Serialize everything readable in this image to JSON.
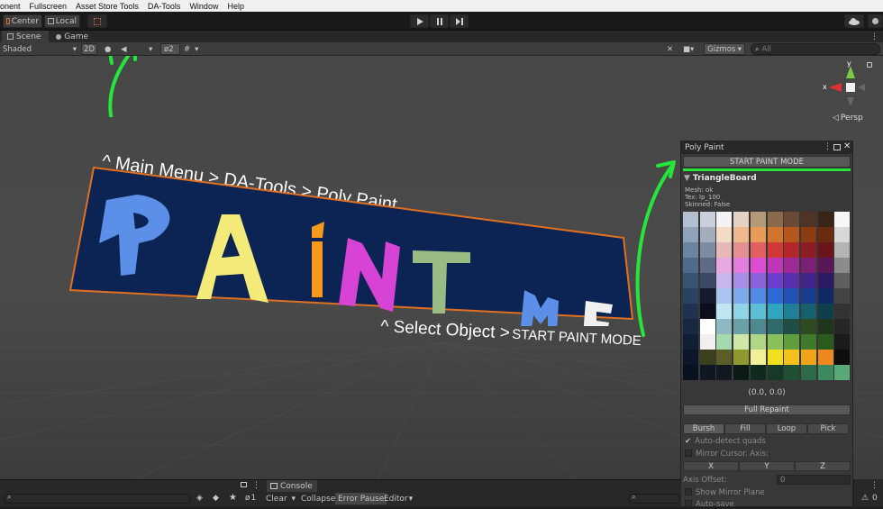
{
  "menubar": {
    "items": [
      "onent",
      "Fullscreen",
      "Asset Store Tools",
      "DA-Tools",
      "Window",
      "Help"
    ]
  },
  "toolbar": {
    "center_label": "Center",
    "local_label": "Local",
    "play_icon": "play-icon",
    "pause_icon": "pause-icon",
    "step_icon": "step-icon"
  },
  "tabs": {
    "scene": "Scene",
    "game": "Game"
  },
  "scene_toolbar": {
    "shading_mode": "Shaded",
    "mode_2d": "2D",
    "hidden_count": "2",
    "gizmos_label": "Gizmos",
    "search_placeholder": "All"
  },
  "gizmo": {
    "x_label": "x",
    "y_label": "y",
    "projection": "Persp"
  },
  "annotations": {
    "main_menu_hint": "^ Main Menu > DA-Tools > Poly Paint",
    "select_hint_prefix": "^ Select Object >",
    "select_hint_action": "START PAINT MODE",
    "arrow_color": "#25e53a"
  },
  "board": {
    "word1": "PAINT",
    "word2": "ME",
    "background": "#0b2454",
    "border": "#e0701f",
    "letter_colors": [
      "#5b8fe8",
      "#f3ea7a",
      "#f59a1a",
      "#d743d4",
      "#9abb83",
      "#5b8fe8",
      "#f0f0f0"
    ]
  },
  "poly_paint": {
    "title": "Poly Paint",
    "start_button": "START PAINT MODE",
    "object_name": "TriangleBoard",
    "mesh_info": "Mesh: ok",
    "tex_info": "Tex: lp_100",
    "skinned_info": "Skinned: False",
    "coords": "(0.0, 0.0)",
    "full_repaint": "Full Repaint",
    "tool_tabs": [
      "Bursh",
      "Fill",
      "Loop",
      "Pick"
    ],
    "auto_detect_quads": "Auto-detect quads",
    "mirror_cursor": "Mirror Cursor. Axis:",
    "axes": [
      "X",
      "Y",
      "Z"
    ],
    "axis_offset_label": "Axis Offset:",
    "axis_offset_value": "0",
    "show_mirror_plane": "Show Mirror Plane",
    "auto_save": "Auto-save",
    "palette": [
      [
        "#b2bfd1",
        "#c9d0db",
        "#f3f3f3",
        "#e2d3c5",
        "#b59a78",
        "#8a6a4b",
        "#6a4a36",
        "#4f3325",
        "#3a2418",
        "#f7f7f7"
      ],
      [
        "#8ea2b9",
        "#a3adbc",
        "#f3dcc6",
        "#efb98e",
        "#e89a58",
        "#d1742e",
        "#b3571e",
        "#8c3c13",
        "#6c2a0e",
        "#d8d8d8"
      ],
      [
        "#6b84a0",
        "#7f8ba0",
        "#e6b8b8",
        "#e49090",
        "#e06060",
        "#d23838",
        "#b3262a",
        "#8d1c23",
        "#6b1419",
        "#b4b4b4"
      ],
      [
        "#4f6a8a",
        "#5d6b85",
        "#e8a9e3",
        "#e27fde",
        "#db4ed4",
        "#bf36b9",
        "#9b2a95",
        "#7a2075",
        "#5a1757",
        "#8c8c8c"
      ],
      [
        "#3a5372",
        "#3a4864",
        "#c8b6ef",
        "#a98de6",
        "#8a62dc",
        "#6d3fd0",
        "#5630ad",
        "#412488",
        "#2d1962",
        "#5f5f5f"
      ],
      [
        "#2b4260",
        "#141a2e",
        "#a9c4f0",
        "#7ea9ec",
        "#4f8ae6",
        "#2d6ad8",
        "#2152b4",
        "#183d8d",
        "#0f2964",
        "#444444"
      ],
      [
        "#1f3350",
        "#0b0f1c",
        "#bfe6f2",
        "#8ed3e6",
        "#5cbfd6",
        "#2fa5bf",
        "#207f94",
        "#185f6e",
        "#0f3f4a",
        "#333333"
      ],
      [
        "#162842",
        "#ffffff",
        "#8fb9c2",
        "#6aa0a8",
        "#4d8a8f",
        "#2e6b6a",
        "#1f4e45",
        "#2e4a1f",
        "#20361a",
        "#262626"
      ],
      [
        "#101f35",
        "#f0f0f0",
        "#a6d9b0",
        "#cfe8a8",
        "#aed685",
        "#89c05c",
        "#5e9e3d",
        "#3f7a2a",
        "#2b5a1e",
        "#1a1a1a"
      ],
      [
        "#0c172a",
        "#3a3f1d",
        "#5a5d25",
        "#8f9a2e",
        "#f3f09a",
        "#f0e020",
        "#f3c21c",
        "#f0a419",
        "#f08820",
        "#0d0d0d"
      ],
      [
        "#08111f",
        "#0e1722",
        "#101820",
        "#0c1a16",
        "#0f2a1e",
        "#173a27",
        "#1f5035",
        "#2e6a4a",
        "#3c8a5e",
        "#57aa78"
      ]
    ]
  },
  "console": {
    "tab_label": "Console",
    "clear_label": "Clear",
    "collapse_label": "Collapse",
    "error_pause_label": "Error Pause",
    "editor_label": "Editor",
    "hidden_count": "1",
    "right_count": "0"
  },
  "colors": {
    "menubar_bg": "#f0f0f0",
    "toolbar_bg": "#191919",
    "panel_bg": "#383838",
    "green_accent": "#25e53a",
    "console_bg": "#282828"
  }
}
